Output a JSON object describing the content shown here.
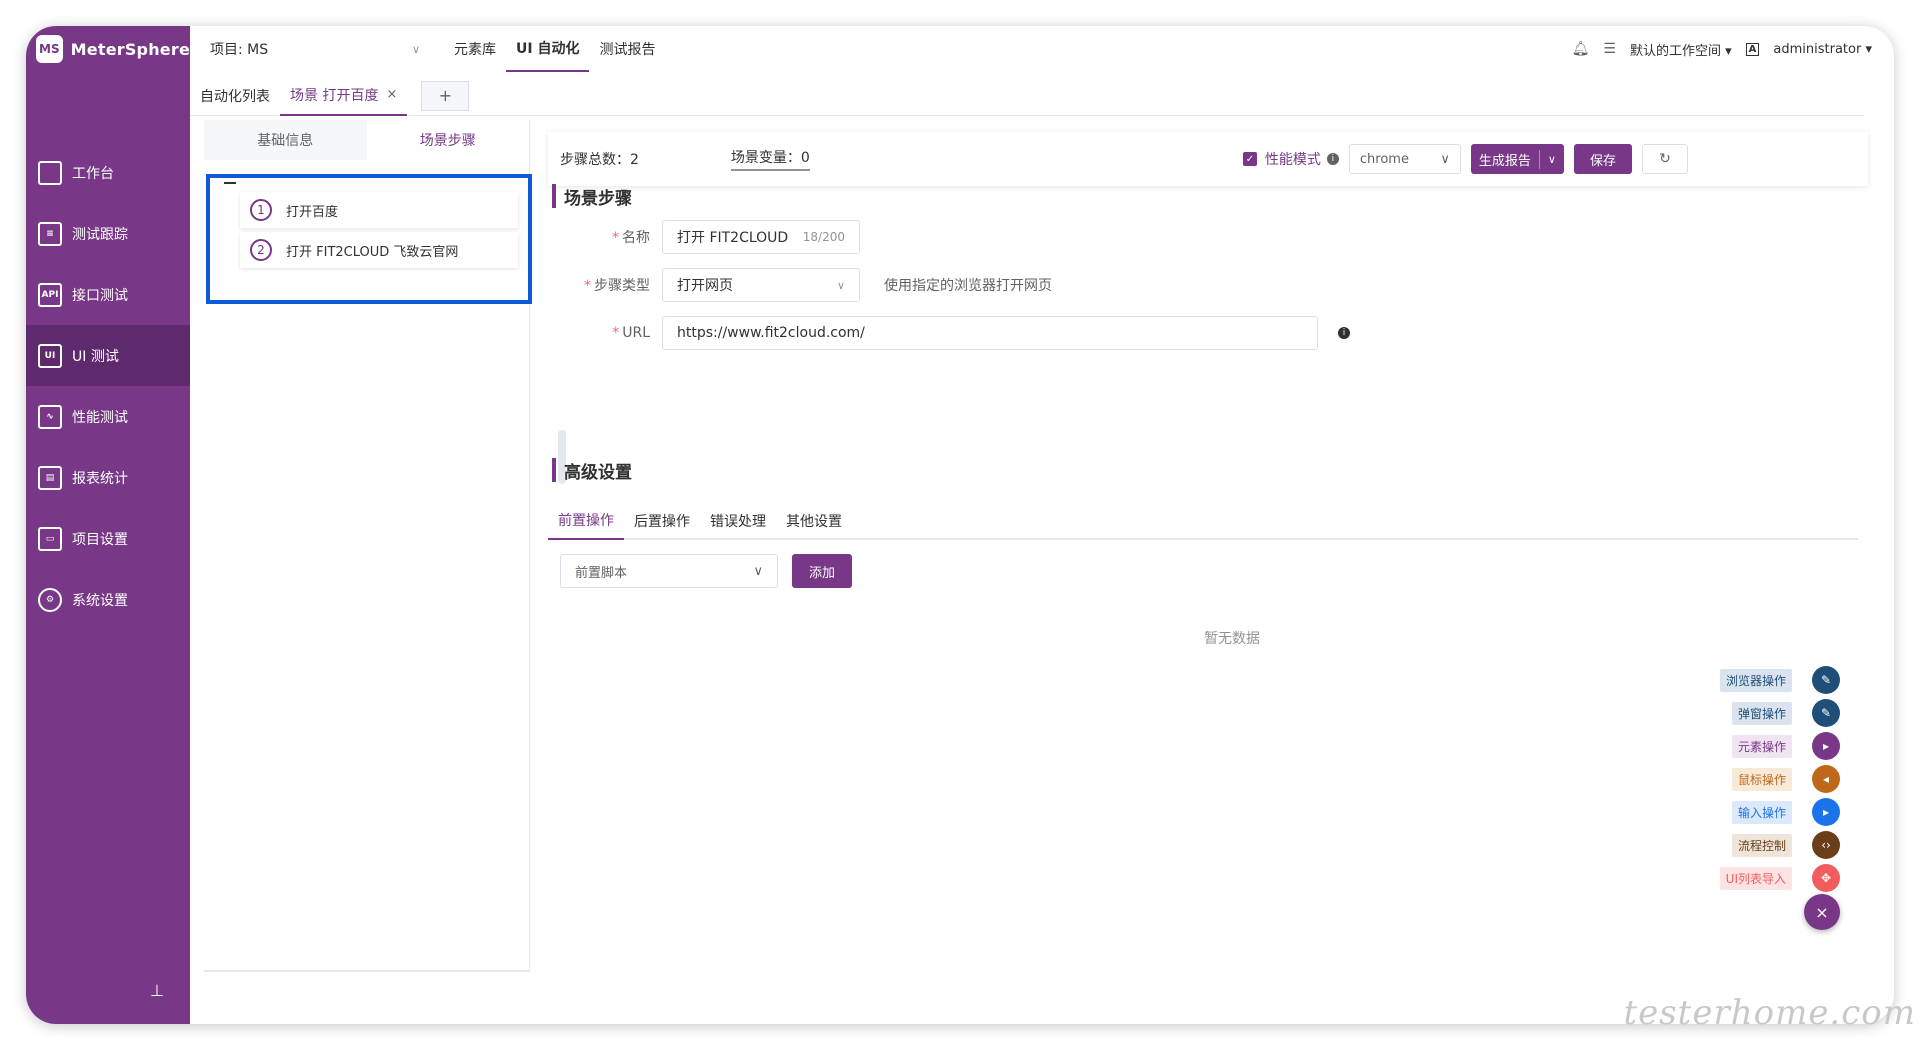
{
  "brand": {
    "logo_mark": "MS",
    "name": "MeterSphere"
  },
  "sidebar": {
    "items": [
      {
        "label": "工作台",
        "icon": "monitor-icon",
        "glyph": ""
      },
      {
        "label": "测试跟踪",
        "icon": "clipboard-icon",
        "glyph": "≡"
      },
      {
        "label": "接口测试",
        "icon": "api-icon",
        "glyph": "API"
      },
      {
        "label": "UI 测试",
        "icon": "ui-icon",
        "glyph": "UI"
      },
      {
        "label": "性能测试",
        "icon": "chart-icon",
        "glyph": "∿"
      },
      {
        "label": "报表统计",
        "icon": "report-icon",
        "glyph": "▤"
      },
      {
        "label": "项目设置",
        "icon": "folder-icon",
        "glyph": "▭"
      },
      {
        "label": "系统设置",
        "icon": "gear-icon",
        "glyph": "⚙"
      }
    ],
    "pin": "⊥"
  },
  "header": {
    "project": "项目: MS",
    "nav": [
      "元素库",
      "UI 自动化",
      "测试报告"
    ],
    "workspace": "默认的工作空间",
    "lang": "A",
    "user": "administrator"
  },
  "tabs": {
    "list_label": "自动化列表",
    "scene_tab": "场景 打开百度",
    "close": "×",
    "add": "+"
  },
  "left_panel": {
    "subtabs": [
      "基础信息",
      "场景步骤"
    ],
    "steps": [
      {
        "num": "1",
        "label": "打开百度"
      },
      {
        "num": "2",
        "label": "打开 FIT2CLOUD 飞致云官网"
      }
    ]
  },
  "toolbar": {
    "step_total": "步骤总数：2",
    "scene_vars": "场景变量：0",
    "perf_mode": "性能模式",
    "browser": "chrome",
    "report": "生成报告",
    "save": "保存",
    "refresh": "↻"
  },
  "scene_step": {
    "title": "场景步骤",
    "name_label": "名称",
    "name_value": "打开 FIT2CLOUD",
    "name_count": "18/200",
    "type_label": "步骤类型",
    "type_value": "打开网页",
    "type_hint": "使用指定的浏览器打开网页",
    "url_label": "URL",
    "url_value": "https://www.fit2cloud.com/"
  },
  "advanced": {
    "title": "高级设置",
    "tabs": [
      "前置操作",
      "后置操作",
      "错误处理",
      "其他设置"
    ],
    "script_select": "前置脚本",
    "add": "添加",
    "empty": "暂无数据"
  },
  "fab": [
    {
      "label": "浏览器操作",
      "color": "#1f4e79",
      "label_bg": "#dbe4ee",
      "label_color": "#1f4e79",
      "glyph": "✎"
    },
    {
      "label": "弹窗操作",
      "color": "#1f4e79",
      "label_bg": "#dbe4ee",
      "label_color": "#1f4e79",
      "glyph": "✎"
    },
    {
      "label": "元素操作",
      "color": "#783887",
      "label_bg": "#f0e4f2",
      "label_color": "#783887",
      "glyph": "▸"
    },
    {
      "label": "鼠标操作",
      "color": "#c0681a",
      "label_bg": "#f7ead9",
      "label_color": "#c0681a",
      "glyph": "◂"
    },
    {
      "label": "输入操作",
      "color": "#1a73e8",
      "label_bg": "#dce9fb",
      "label_color": "#1a73e8",
      "glyph": "▸"
    },
    {
      "label": "流程控制",
      "color": "#6b3e1a",
      "label_bg": "#eee4da",
      "label_color": "#6b3e1a",
      "glyph": "‹›"
    },
    {
      "label": "UI列表导入",
      "color": "#f25c5c",
      "label_bg": "#fde4e4",
      "label_color": "#f25c5c",
      "glyph": "✥"
    }
  ],
  "fab_close": "×",
  "watermark": "testerhome.com"
}
